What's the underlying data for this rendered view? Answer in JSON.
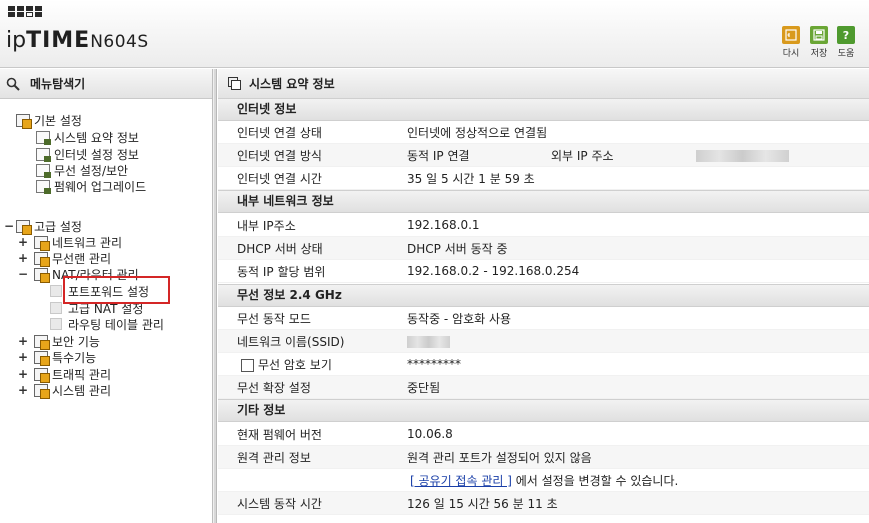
{
  "header": {
    "logo_ip": "ip",
    "logo_time": "TIME",
    "model": "N604S",
    "buttons": [
      {
        "label": "다시",
        "icon": "undo-icon",
        "color": "#d99a1d"
      },
      {
        "label": "저장",
        "icon": "save-icon",
        "color": "#6aa635"
      },
      {
        "label": "도움",
        "icon": "help-icon",
        "color": "#4f9a2f"
      }
    ]
  },
  "sidebar": {
    "title": "메뉴탐색기",
    "basic": {
      "label": "기본 설정",
      "items": [
        "시스템 요약 정보",
        "인터넷 설정 정보",
        "무선 설정/보안",
        "펌웨어 업그레이드"
      ]
    },
    "advanced": {
      "label": "고급 설정",
      "items": [
        {
          "toggle": "+",
          "label": "네트워크 관리"
        },
        {
          "toggle": "+",
          "label": "무선랜 관리"
        },
        {
          "toggle": "−",
          "label": "NAT/라우터 관리"
        },
        {
          "toggle": "+",
          "label": "보안 기능"
        },
        {
          "toggle": "+",
          "label": "특수기능"
        },
        {
          "toggle": "+",
          "label": "트래픽 관리"
        },
        {
          "toggle": "+",
          "label": "시스템 관리"
        }
      ],
      "nat_children": [
        "포트포워드 설정",
        "고급 NAT 설정",
        "라우팅 테이블 관리"
      ]
    },
    "basic_toggle": "",
    "advanced_toggle": "−"
  },
  "main": {
    "title": "시스템 요약 정보",
    "internet": {
      "title": "인터넷 정보",
      "conn_status_label": "인터넷 연결 상태",
      "conn_status_value": "인터넷에 정상적으로 연결됨",
      "conn_method_label": "인터넷 연결 방식",
      "conn_method_value": "동적 IP 연결",
      "external_ip_label": "외부 IP 주소",
      "conn_time_label": "인터넷 연결 시간",
      "conn_time_value": "35 일 5 시간 1 분 59 초"
    },
    "internal": {
      "title": "내부 네트워크 정보",
      "ip_label": "내부 IP주소",
      "ip_value": "192.168.0.1",
      "dhcp_label": "DHCP 서버 상태",
      "dhcp_value": "DHCP 서버 동작 중",
      "range_label": "동적 IP 할당 범위",
      "range_value": "192.168.0.2 -  192.168.0.254"
    },
    "wireless": {
      "title": "무선 정보 2.4 GHz",
      "mode_label": "무선 동작 모드",
      "mode_value": "동작중 - 암호화 사용",
      "ssid_label": "네트워크 이름(SSID)",
      "show_pw_label": "무선 암호 보기",
      "pw_value": "*********",
      "ext_label": "무선 확장 설정",
      "ext_value": "중단됨"
    },
    "other": {
      "title": "기타 정보",
      "fw_label": "현재 펌웨어 버전",
      "fw_value": "10.06.8",
      "remote_label": "원격 관리 정보",
      "remote_value": "원격 관리 포트가 설정되어 있지 않음",
      "remote_link": "[ 공유기 접속 관리 ]",
      "remote_link_suffix": " 에서 설정을 변경할 수 있습니다.",
      "uptime_label": "시스템 동작 시간",
      "uptime_value": "126 일 15 시간 56 분 11 초"
    }
  }
}
